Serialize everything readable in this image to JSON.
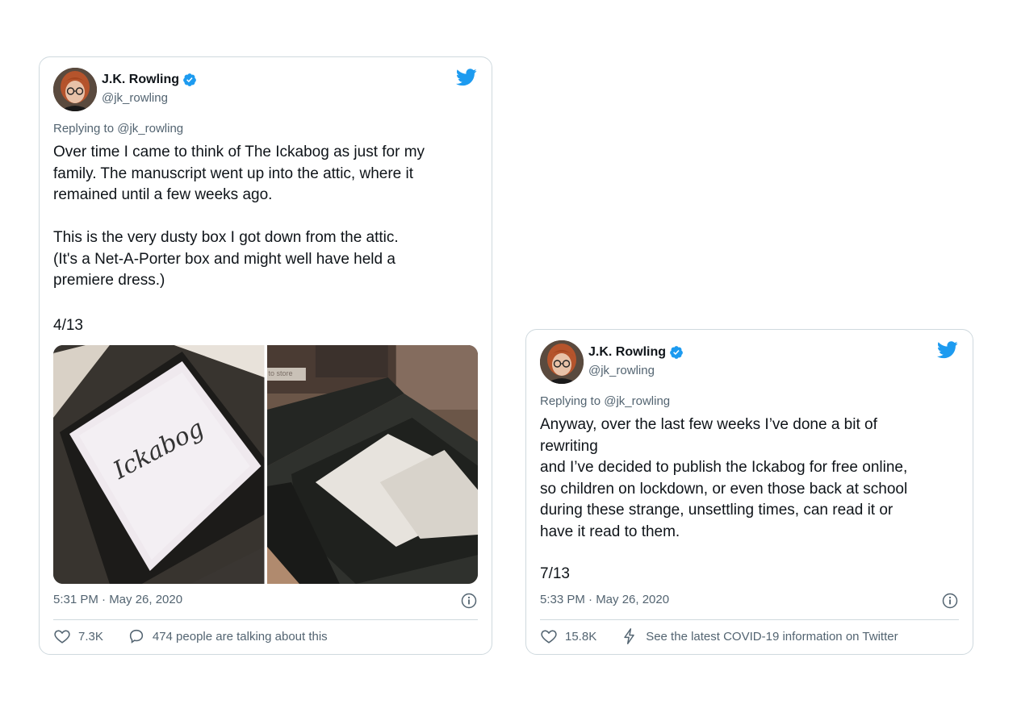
{
  "tweet1": {
    "author_name": "J.K. Rowling",
    "handle": "@jk_rowling",
    "replying_to": "Replying to @jk_rowling",
    "body": "Over time I came to think of The Ickabog as just for my\nfamily. The manuscript went up into the attic, where it\nremained until a few weeks ago.\n\nThis is the very dusty box I got down from the attic.\n(It's a Net-A-Porter box and might well have held a\npremiere dress.)",
    "counter": "4/13",
    "photo1_text": "Ickabog",
    "photo2_text": "to store",
    "timestamp": "5:31 PM · May 26, 2020",
    "likes": "7.3K",
    "conversation": "474 people are talking about this"
  },
  "tweet2": {
    "author_name": "J.K. Rowling",
    "handle": "@jk_rowling",
    "replying_to": "Replying to @jk_rowling",
    "body": "Anyway, over the last few weeks I’ve done a bit of\nrewriting\nand I’ve decided to publish the Ickabog for free online,\nso children on lockdown, or even those back at school\nduring these strange, unsettling times, can read it or\nhave it read to them.",
    "counter": "7/13",
    "timestamp": "5:33 PM · May 26, 2020",
    "likes": "15.8K",
    "covid_link": "See the latest COVID-19 information on Twitter"
  },
  "colors": {
    "twitter_blue": "#1d9bf0",
    "secondary_text": "#536471",
    "border": "#cfd9de"
  }
}
